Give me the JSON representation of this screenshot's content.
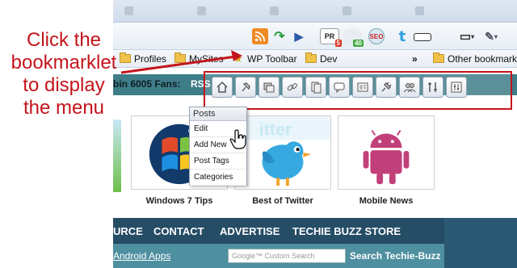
{
  "annotation": {
    "lines": [
      "Click the",
      "bookmarklet",
      "to display",
      "the menu"
    ],
    "color": "#c4141b"
  },
  "bookmarks_bar": {
    "items": [
      {
        "label": "Profiles",
        "icon": "folder-icon"
      },
      {
        "label": "MySites",
        "icon": "folder-icon"
      },
      {
        "label": "WP Toolbar",
        "icon": "star-bookmark-icon"
      },
      {
        "label": "Dev",
        "icon": "folder-icon"
      },
      {
        "label": "»",
        "icon": "overflow-chevron"
      },
      {
        "label": "Other bookmarks",
        "icon": "folder-icon"
      }
    ]
  },
  "browser_toolbar": {
    "buttons": [
      "rss-icon",
      "refresh-icon",
      "play-icon",
      "pagerank-badge",
      "fans-counter-badge",
      "seo-icon",
      "twitter-icon",
      "ruler-icon",
      "page-menu-icon",
      "wrench-menu-icon"
    ],
    "pagerank_label": "PR",
    "pagerank_value": "5",
    "fans_badge_value": "40",
    "seo_label": "SEO"
  },
  "wp_toolbar": {
    "icons": [
      "home-icon",
      "pin-icon",
      "media-icon",
      "link-icon",
      "pages-icon",
      "comments-icon",
      "appearance-icon",
      "plugins-icon",
      "users-icon",
      "tools-icon",
      "settings-icon"
    ]
  },
  "page": {
    "fans_text": "bin 6005 Fans:",
    "rss_text": "RSS F",
    "thumbnails": [
      {
        "label": "Windows 7 Tips",
        "image": "windows-7-logo"
      },
      {
        "label": "Best of Twitter",
        "image": "twitter-bird"
      },
      {
        "label": "Mobile News",
        "image": "android-robot"
      }
    ],
    "posts_menu": {
      "title": "Posts",
      "items": [
        "Edit",
        "Add New",
        "Post Tags",
        "Categories"
      ]
    },
    "nav_items": [
      "URCE",
      "CONTACT",
      "ADVERTISE",
      "TECHIE BUZZ STORE"
    ],
    "android_link": "Android Apps",
    "search_placeholder": "Google™ Custom Search",
    "search_label": "Search Techie-Buzz"
  }
}
